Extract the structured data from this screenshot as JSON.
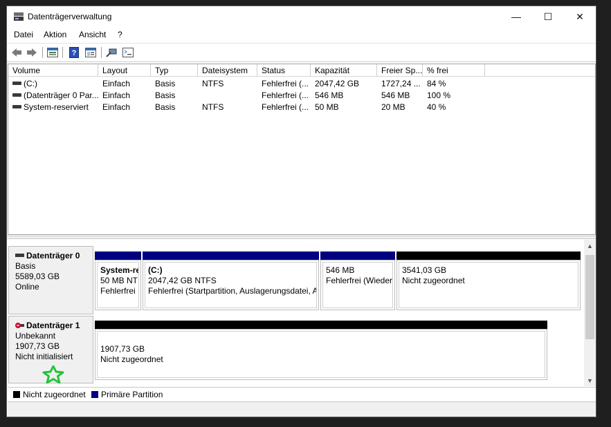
{
  "window": {
    "title": "Datenträgerverwaltung",
    "controls": {
      "minimize": "—",
      "maximize": "☐",
      "close": "✕"
    }
  },
  "menu": [
    {
      "label": "Datei"
    },
    {
      "label": "Aktion"
    },
    {
      "label": "Ansicht"
    },
    {
      "label": "?"
    }
  ],
  "toolbar": {
    "icons": [
      "back-icon",
      "forward-icon",
      "disk-list-icon",
      "help-icon",
      "properties-icon",
      "connect-icon",
      "console-icon"
    ]
  },
  "volume_table": {
    "columns": [
      "Volume",
      "Layout",
      "Typ",
      "Dateisystem",
      "Status",
      "Kapazität",
      "Freier Sp...",
      "% frei"
    ],
    "rows": [
      {
        "volume": "(C:)",
        "layout": "Einfach",
        "typ": "Basis",
        "fs": "NTFS",
        "status": "Fehlerfrei (...",
        "capacity": "2047,42 GB",
        "free": "1727,24 ...",
        "pct": "84 %"
      },
      {
        "volume": "(Datenträger 0 Par...",
        "layout": "Einfach",
        "typ": "Basis",
        "fs": "",
        "status": "Fehlerfrei (...",
        "capacity": "546 MB",
        "free": "546 MB",
        "pct": "100 %"
      },
      {
        "volume": "System-reserviert",
        "layout": "Einfach",
        "typ": "Basis",
        "fs": "NTFS",
        "status": "Fehlerfrei (...",
        "capacity": "50 MB",
        "free": "20 MB",
        "pct": "40 %"
      }
    ]
  },
  "disks": [
    {
      "name": "Datenträger 0",
      "type": "Basis",
      "size": "5589,03 GB",
      "state": "Online",
      "partitions": [
        {
          "line1": "System-re",
          "line2": "50 MB NTI",
          "line3": "Fehlerfrei"
        },
        {
          "line1": "(C:)",
          "line2": "2047,42 GB NTFS",
          "line3": "Fehlerfrei (Startpartition, Auslagerungsdatei, A"
        },
        {
          "line1": "",
          "line2": "546 MB",
          "line3": "Fehlerfrei (Wiederl"
        },
        {
          "line1": "",
          "line2": "3541,03 GB",
          "line3": "Nicht zugeordnet"
        }
      ]
    },
    {
      "name": "Datenträger 1",
      "type": "Unbekannt",
      "size": "1907,73 GB",
      "state": "Nicht initialisiert",
      "partitions": [
        {
          "line1": "1907,73 GB",
          "line2": "Nicht zugeordnet"
        }
      ]
    }
  ],
  "legend": [
    {
      "label": "Nicht zugeordnet",
      "color": "#000000"
    },
    {
      "label": "Primäre Partition",
      "color": "#000080"
    }
  ],
  "colors": {
    "primary_partition": "#000080",
    "unallocated": "#000000",
    "star_marker": "#22c33a"
  }
}
